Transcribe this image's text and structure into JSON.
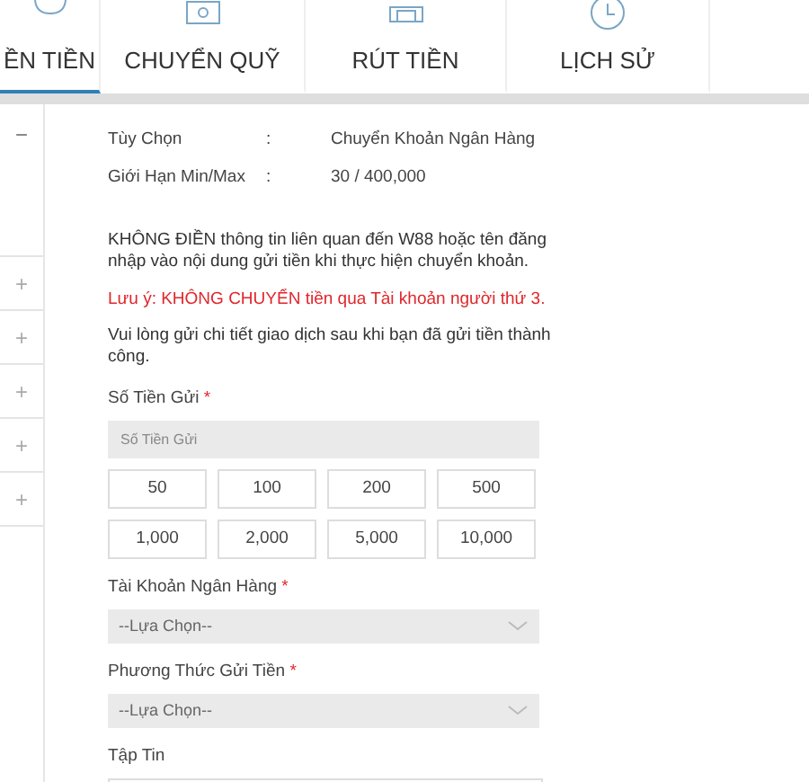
{
  "tabs": [
    {
      "label": "ỀN TIỀN",
      "selected": true
    },
    {
      "label": "CHUYỂN QUỸ",
      "selected": false
    },
    {
      "label": "RÚT TIỀN",
      "selected": false
    },
    {
      "label": "LỊCH SỬ",
      "selected": false
    }
  ],
  "sidebar": {
    "items": [
      {
        "symbol": "−",
        "expanded": true
      },
      {
        "symbol": "+",
        "expanded": false
      },
      {
        "symbol": "+",
        "expanded": false
      },
      {
        "symbol": "+",
        "expanded": false
      },
      {
        "symbol": "+",
        "expanded": false
      },
      {
        "symbol": "+",
        "expanded": false
      }
    ]
  },
  "info": [
    {
      "label": "Tùy Chọn",
      "separator": ":",
      "value": "Chuyển Khoản Ngân Hàng"
    },
    {
      "label": "Giới Hạn Min/Max",
      "separator": ":",
      "value": "30 / 400,000"
    }
  ],
  "notes": [
    {
      "text": "KHÔNG ĐIỀN thông tin liên quan đến W88 hoặc tên đăng nhập vào nội dung gửi tiền khi thực hiện chuyển khoản.",
      "kind": "normal"
    },
    {
      "text": "Lưu ý: KHÔNG CHUYỂN tiền qua Tài khoản người thứ 3.",
      "kind": "warning"
    },
    {
      "text": "Vui lòng gửi chi tiết giao dịch sau khi bạn đã gửi tiền thành công.",
      "kind": "normal"
    }
  ],
  "amount": {
    "label": "Số Tiền Gửi",
    "required": "*",
    "placeholder": "Số Tiền Gửi"
  },
  "quick_amounts": [
    "50",
    "100",
    "200",
    "500",
    "1,000",
    "2,000",
    "5,000",
    "10,000"
  ],
  "selects": [
    {
      "label": "Tài Khoản Ngân Hàng",
      "required": "*",
      "value": "--Lựa Chọn--"
    },
    {
      "label": "Phương Thức Gửi Tiền",
      "required": "*",
      "value": "--Lựa Chọn--"
    }
  ],
  "file": {
    "label": "Tập Tin"
  }
}
